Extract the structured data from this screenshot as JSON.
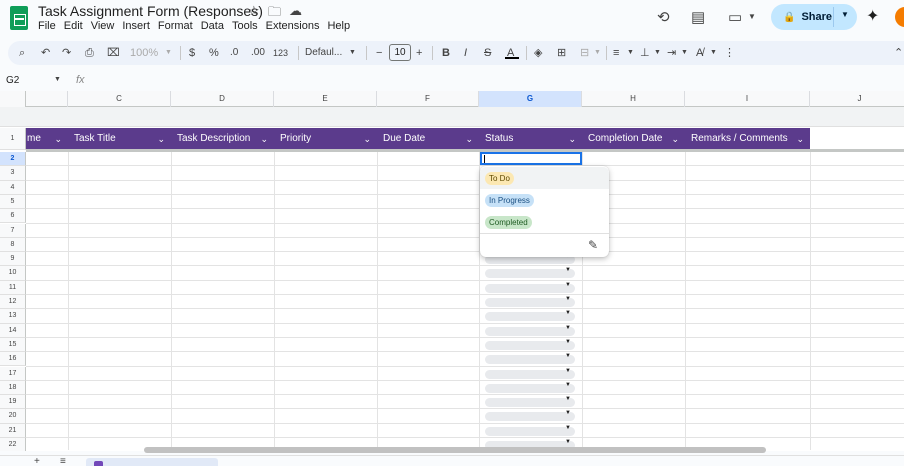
{
  "app": {
    "title": "Task Assignment Form  (Responses)",
    "share_label": "Share",
    "icons": [
      "star-icon",
      "move-to-folder-icon",
      "cloud-status-icon",
      "history-icon",
      "comment-icon",
      "meet-icon",
      "lock-icon",
      "gemini-icon"
    ]
  },
  "menu": [
    "File",
    "Edit",
    "View",
    "Insert",
    "Format",
    "Data",
    "Tools",
    "Extensions",
    "Help"
  ],
  "toolbar": {
    "zoom": "100%",
    "currency": "$",
    "percent": "%",
    "decrease_decimal": ".0",
    "increase_decimal": ".00",
    "number_format": "123",
    "font": "Defaul...",
    "font_size": "10"
  },
  "formula_bar": {
    "name_box": "G2",
    "fx": "fx"
  },
  "columns": [
    "C",
    "D",
    "E",
    "F",
    "G",
    "H",
    "I",
    "J"
  ],
  "header_row_number": "1",
  "rows": [
    "2",
    "3",
    "4",
    "5",
    "6",
    "7",
    "8",
    "9",
    "10",
    "11",
    "12",
    "13",
    "14",
    "15",
    "16",
    "17",
    "18",
    "19",
    "20",
    "21",
    "22"
  ],
  "table_headers": [
    "me",
    "Task Title",
    "Task Description",
    "Priority",
    "Due Date",
    "Status",
    "Completion Date",
    "Remarks / Comments"
  ],
  "status_dropdown": {
    "options": [
      {
        "label": "To Do",
        "bg": "#fce8b2",
        "fg": "#5f4a00"
      },
      {
        "label": "In Progress",
        "bg": "#c6e1f7",
        "fg": "#1a4f82"
      },
      {
        "label": "Completed",
        "bg": "#c8e6c9",
        "fg": "#1e5b22"
      }
    ]
  },
  "colors": {
    "header_bg": "#5b3b8c",
    "selection": "#1a73e8",
    "share_bg": "#c2e7ff"
  }
}
